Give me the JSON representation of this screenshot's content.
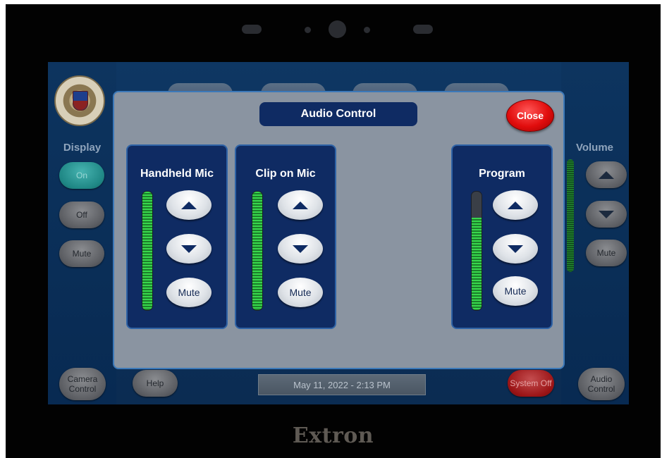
{
  "device": {
    "brand": "Extron"
  },
  "left_sidebar": {
    "title": "Display",
    "buttons": [
      "On",
      "Off",
      "Mute"
    ],
    "camera_control": "Camera Control"
  },
  "right_sidebar": {
    "title": "Volume",
    "mute": "Mute",
    "audio_control": "Audio Control",
    "meter_level": 0.9
  },
  "bottom_bar": {
    "help": "Help",
    "datetime": "May 11, 2022  -  2:13 PM",
    "system_off": "System Off"
  },
  "dialog": {
    "title": "Audio Control",
    "close": "Close",
    "channels": [
      {
        "name": "Handheld Mic",
        "mute": "Mute",
        "level": 1.0
      },
      {
        "name": "Clip on Mic",
        "mute": "Mute",
        "level": 1.0
      },
      {
        "name": "Program",
        "mute": "Mute",
        "level": 0.78
      }
    ]
  },
  "colors": {
    "dialog_bg": "#8a94a1",
    "panel_bg": "#0f2b63",
    "close_red": "#e10d0d",
    "meter_green": "#38d74d"
  }
}
